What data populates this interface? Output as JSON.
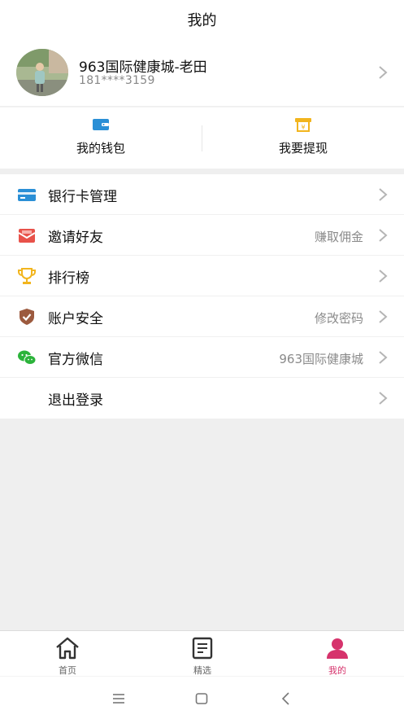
{
  "header": {
    "title": "我的"
  },
  "profile": {
    "name": "963国际健康城-老田",
    "phone": "181****3159"
  },
  "wallet": {
    "items": [
      {
        "label": "我的钱包",
        "icon": "wallet-icon"
      },
      {
        "label": "我要提现",
        "icon": "withdraw-icon"
      }
    ]
  },
  "menu": {
    "items": [
      {
        "label": "银行卡管理",
        "value": "",
        "icon": "bank-card-icon"
      },
      {
        "label": "邀请好友",
        "value": "赚取佣金",
        "icon": "envelope-icon"
      },
      {
        "label": "排行榜",
        "value": "",
        "icon": "trophy-icon"
      },
      {
        "label": "账户安全",
        "value": "修改密码",
        "icon": "shield-icon"
      },
      {
        "label": "官方微信",
        "value": "963国际健康城",
        "icon": "wechat-icon"
      },
      {
        "label": "退出登录",
        "value": "",
        "icon": ""
      }
    ]
  },
  "tabbar": {
    "items": [
      {
        "label": "首页",
        "icon": "home-icon",
        "active": false
      },
      {
        "label": "精选",
        "icon": "document-icon",
        "active": false
      },
      {
        "label": "我的",
        "icon": "user-icon",
        "active": true
      }
    ]
  },
  "colors": {
    "accent": "#d6336c",
    "bank_card": "#2a8fd6",
    "envelope": "#e8524a",
    "trophy": "#f2b51e",
    "shield": "#9c5a3e",
    "wechat": "#2bb33a",
    "wallet": "#2a8fd6",
    "withdraw": "#f2b51e"
  }
}
